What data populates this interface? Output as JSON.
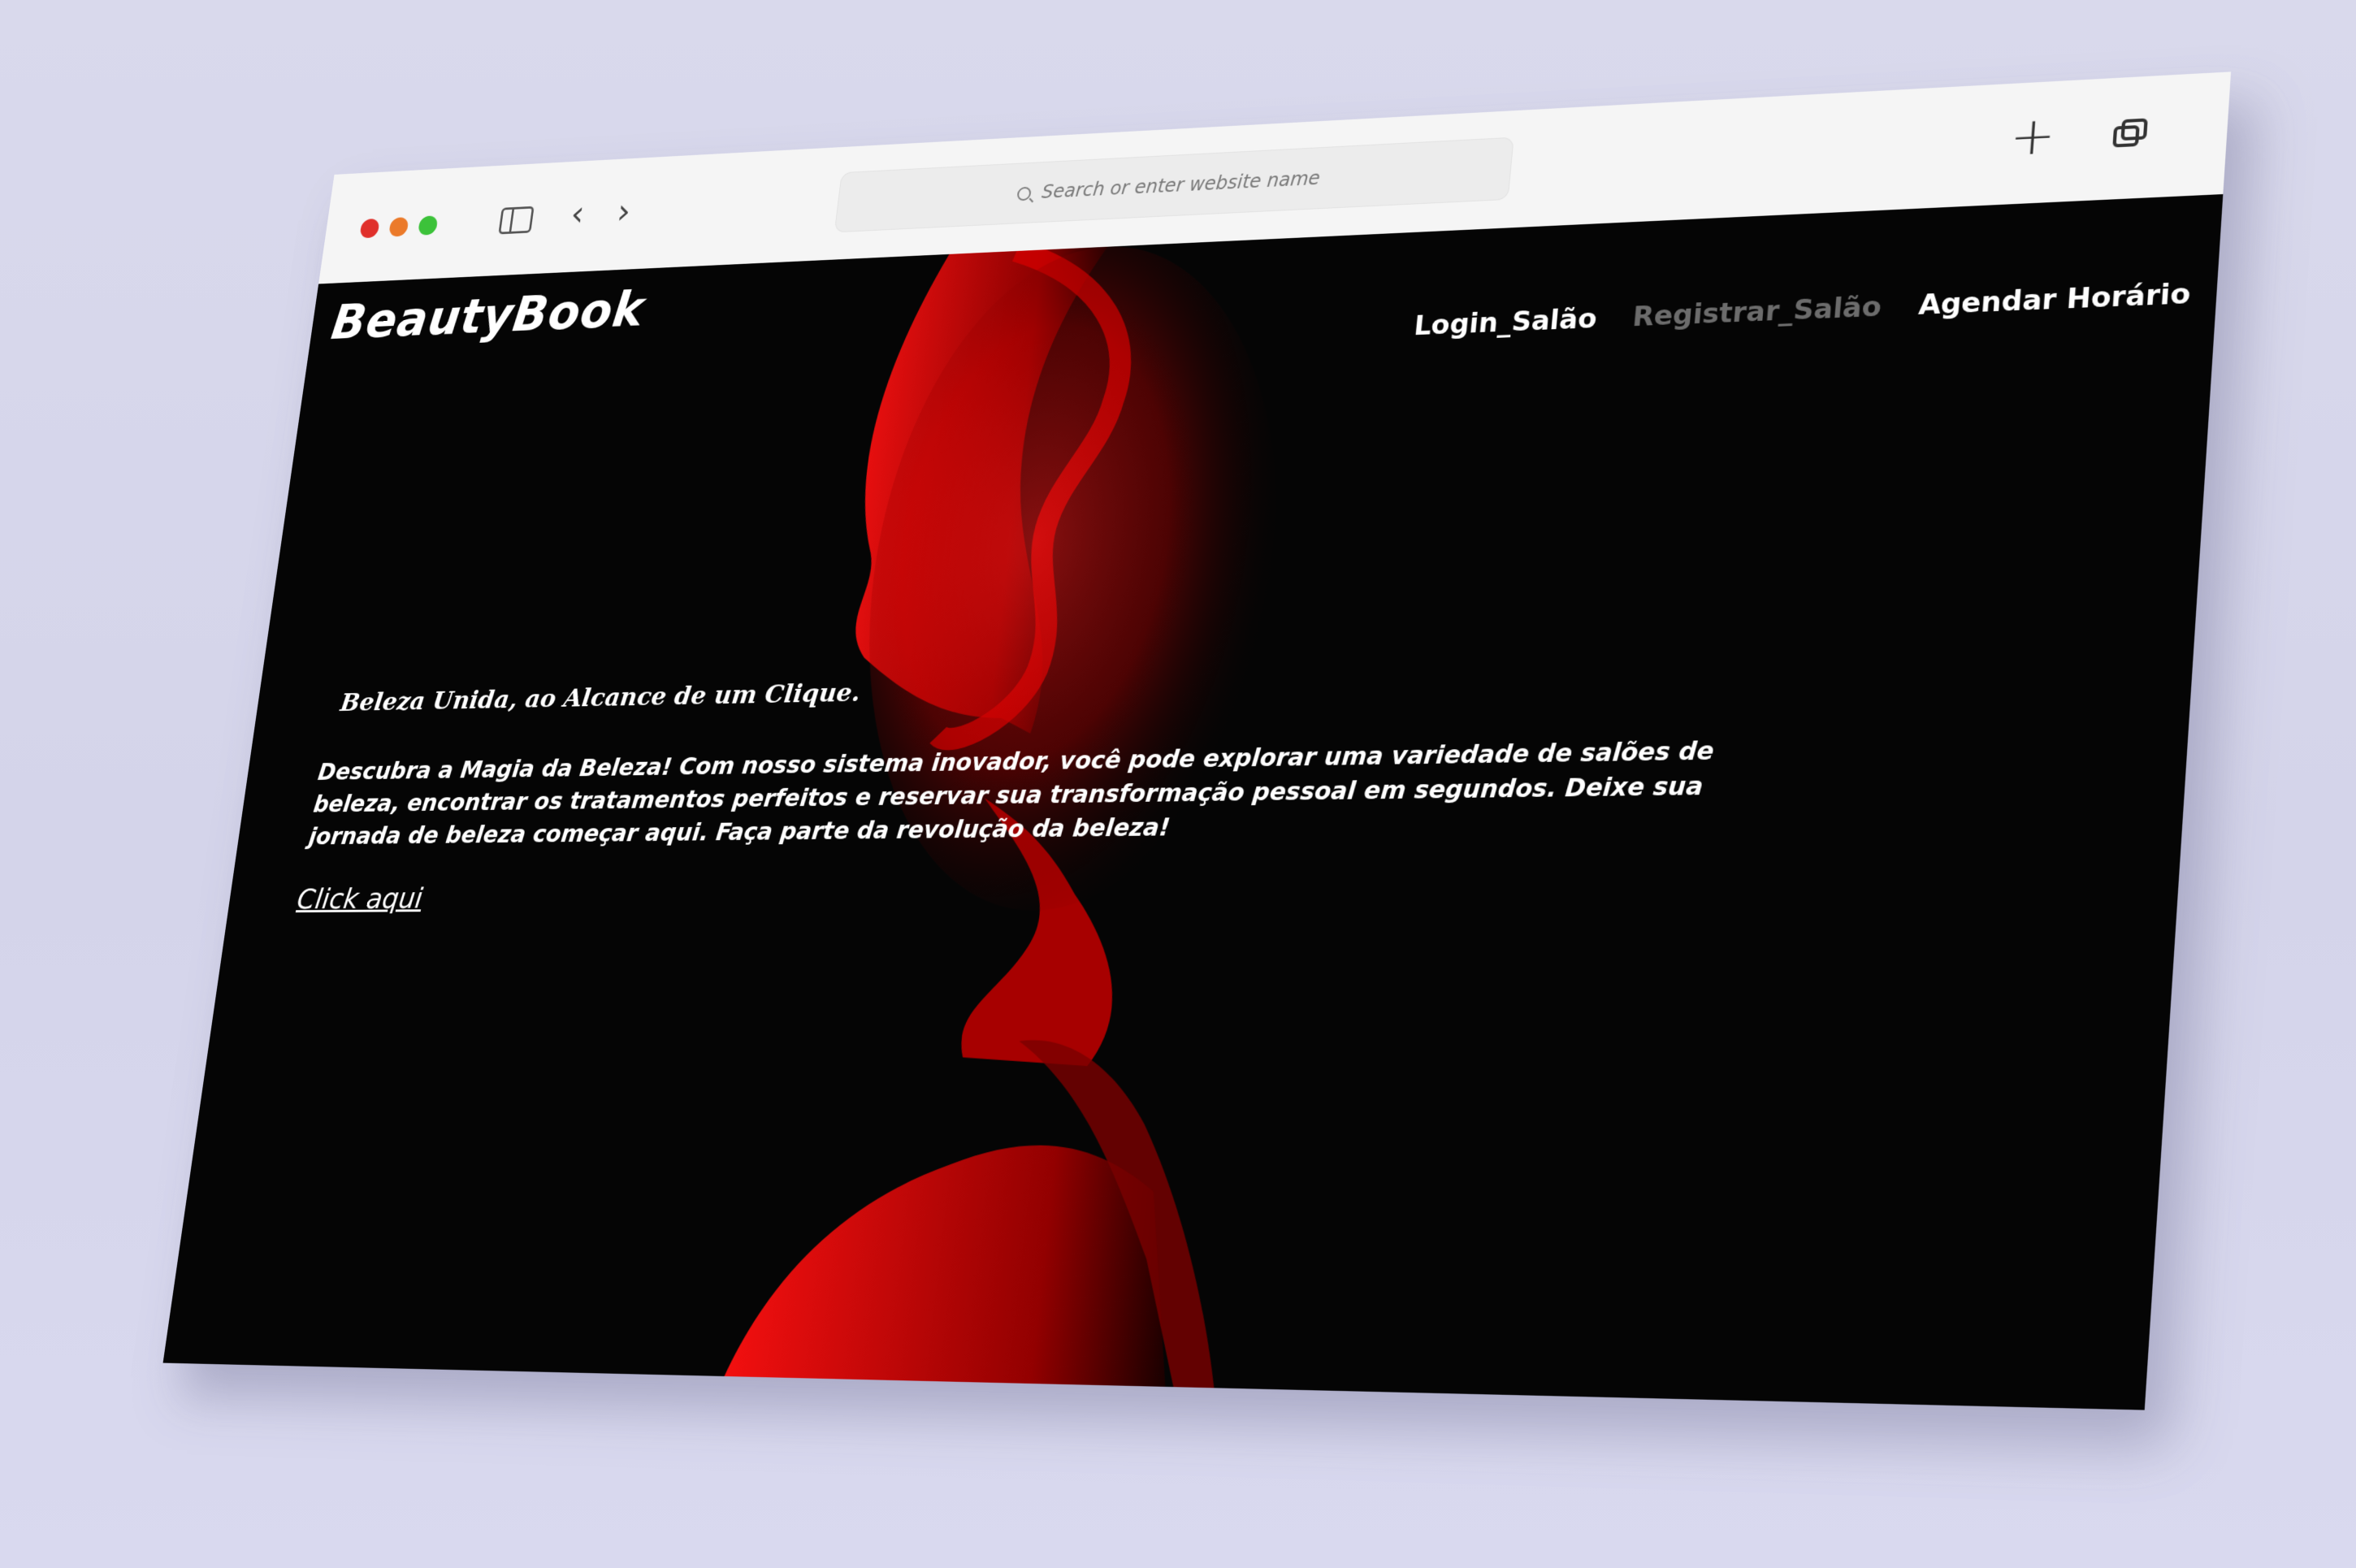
{
  "browser": {
    "address_placeholder": "Search or enter website name",
    "buttons": {
      "back_icon": "‹",
      "forward_icon": "›",
      "new_tab_icon": "+"
    }
  },
  "site": {
    "logo": "BeautyBook",
    "nav": [
      {
        "label": "Login_Salão"
      },
      {
        "label": "Registrar_Salão"
      },
      {
        "label": "Agendar Horário"
      }
    ],
    "hero": {
      "tagline": "Beleza Unida, ao Alcance de um Clique.",
      "description": "Descubra a Magia da Beleza! Com nosso sistema inovador, você pode explorar uma variedade de salões de beleza, encontrar os tratamentos perfeitos e reservar sua transformação pessoal em segundos. Deixe sua jornada de beleza começar aqui. Faça parte da revolução da beleza!",
      "cta": "Click aqui"
    }
  },
  "colors": {
    "page_background": "#050505",
    "accent_red": "#ff0d0d",
    "nav_dim": "#6c6c6c",
    "text": "#ffffff"
  }
}
